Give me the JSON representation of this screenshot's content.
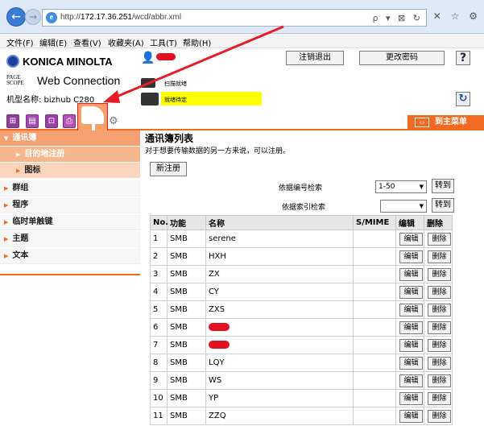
{
  "browser": {
    "url_prefix": "http://",
    "url_host": "172.17.36.251",
    "url_path": "/wcd/abbr.xml",
    "url_tools": "ρ ▾ ⊠ ↻",
    "tb_icons": "✕ ☆ ⚙"
  },
  "menubar": [
    "文件(F)",
    "编辑(E)",
    "查看(V)",
    "收藏夹(A)",
    "工具(T)",
    "帮助(H)"
  ],
  "header": {
    "brand": "KONICA MINOLTA",
    "pagescope_small": "PAGE SCOPE",
    "web_connection": "Web Connection",
    "model": "机型名称: bizhub C280",
    "logout_label": "注销退出",
    "change_pw_label": "更改密码",
    "help_label": "?",
    "refresh_label": "↻",
    "status_lines": [
      "扫描就绪",
      "就绪待定"
    ]
  },
  "tabs": {
    "to_main_label": "到主菜单"
  },
  "sidebar": {
    "items": [
      {
        "label": "通讯簿",
        "kind": "main"
      },
      {
        "label": "目的地注册",
        "kind": "sub"
      },
      {
        "label": "图标",
        "kind": "sub2"
      },
      {
        "label": "群组",
        "kind": "plain"
      },
      {
        "label": "程序",
        "kind": "plain"
      },
      {
        "label": "临时单触键",
        "kind": "plain"
      },
      {
        "label": "主题",
        "kind": "plain"
      },
      {
        "label": "文本",
        "kind": "plain"
      }
    ]
  },
  "main": {
    "title": "通讯簿列表",
    "description": "对于想要传输数据的另一方来说，可以注册。",
    "new_button": "新注册",
    "search_number_label": "依据编号检索",
    "search_number_value": "1-50",
    "search_index_label": "依据索引检索",
    "search_index_value": "",
    "go_label": "转到"
  },
  "table": {
    "headers": [
      "No.",
      "功能",
      "名称",
      "S/MIME",
      "编辑",
      "删除"
    ],
    "edit_label": "编辑",
    "delete_label": "删除",
    "rows": [
      {
        "no": "1",
        "func": "SMB",
        "name": "serene",
        "redacted": false
      },
      {
        "no": "2",
        "func": "SMB",
        "name": "HXH",
        "redacted": false
      },
      {
        "no": "3",
        "func": "SMB",
        "name": "ZX",
        "redacted": false
      },
      {
        "no": "4",
        "func": "SMB",
        "name": "CY",
        "redacted": false
      },
      {
        "no": "5",
        "func": "SMB",
        "name": "ZXS",
        "redacted": false
      },
      {
        "no": "6",
        "func": "SMB",
        "name": "",
        "redacted": true
      },
      {
        "no": "7",
        "func": "SMB",
        "name": "",
        "redacted": true
      },
      {
        "no": "8",
        "func": "SMB",
        "name": "LQY",
        "redacted": false
      },
      {
        "no": "9",
        "func": "SMB",
        "name": "WS",
        "redacted": false
      },
      {
        "no": "10",
        "func": "SMB",
        "name": "YP",
        "redacted": false
      },
      {
        "no": "11",
        "func": "SMB",
        "name": "ZZQ",
        "redacted": false
      }
    ]
  },
  "colors": {
    "accent": "#f26a21",
    "annotation": "#e61d26",
    "status_highlight": "#ffff00"
  },
  "icons": [
    "back-arrow-icon",
    "forward-arrow-icon",
    "ie-icon",
    "user-icon",
    "help-icon",
    "refresh-icon",
    "addressbook-tab-icon",
    "gear-icon"
  ]
}
